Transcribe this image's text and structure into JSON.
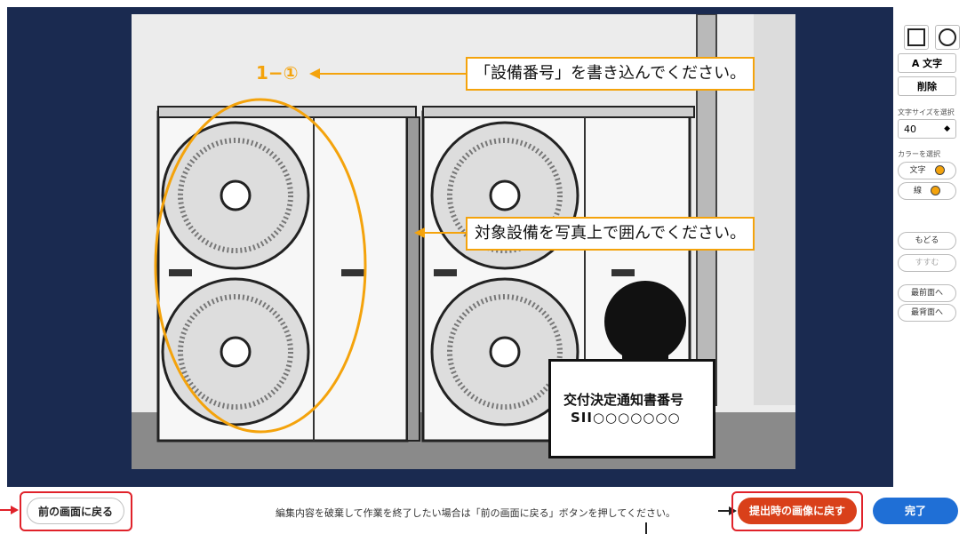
{
  "canvas": {
    "annotation_label": "1−①",
    "callout_top": "「設備番号」を書き込んでください。",
    "callout_middle": "対象設備を写真上で囲んでください。",
    "notice_line1": "交付決定通知書番号",
    "notice_line2": "SII○○○○○○○"
  },
  "toolbar": {
    "rect_tool": "rectangle-tool",
    "circle_tool": "circle-tool",
    "text_button": "A 文字",
    "delete_button": "削除",
    "font_size_label": "文字サイズを選択",
    "font_size_value": "40",
    "color_label": "カラーを選択",
    "color_text_label": "文字",
    "color_line_label": "線",
    "undo_button": "もどる",
    "redo_button": "すすむ",
    "bring_front_button": "最前面へ",
    "send_back_button": "最背面へ"
  },
  "bottom": {
    "back_button": "前の画面に戻る",
    "notice": "編集内容を破棄して作業を終了したい場合は「前の画面に戻る」ボタンを押してください。",
    "reset_button": "提出時の画像に戻す",
    "done_button": "完了"
  },
  "colors": {
    "annotation": "#f4a30c",
    "editor_bg": "#1a2a50",
    "done_button": "#1f6fd6",
    "reset_button": "#d9401a",
    "highlight_frame": "#e0222a"
  }
}
